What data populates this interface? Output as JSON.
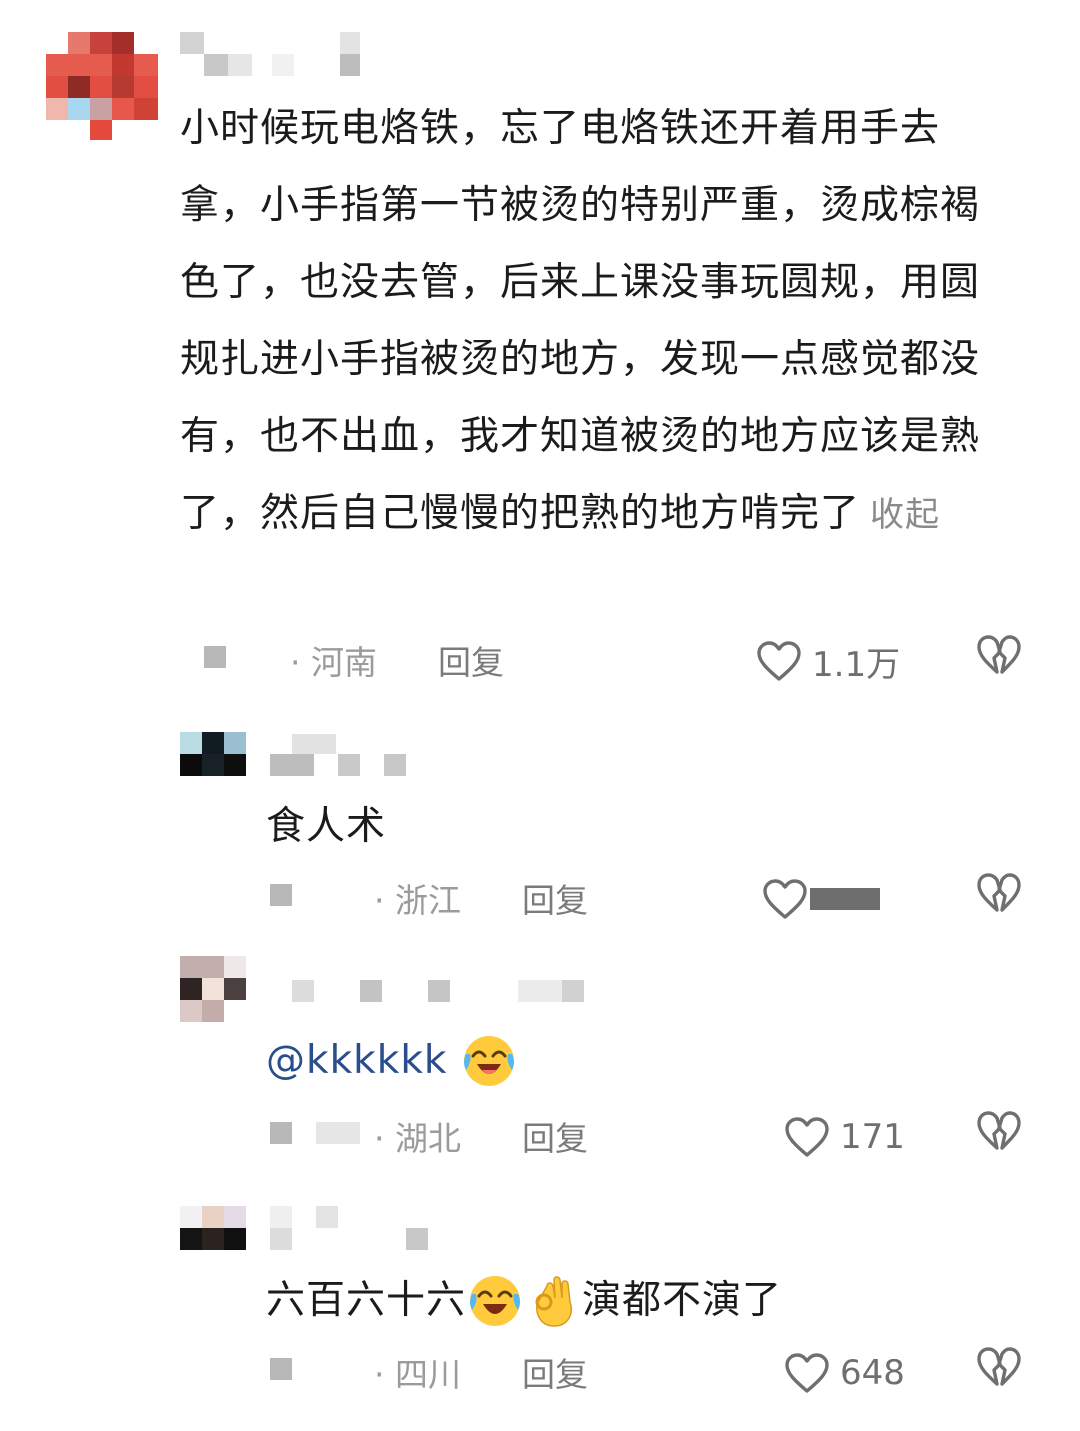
{
  "comments": [
    {
      "text": "小时候玩电烙铁，忘了电烙铁还开着用手去拿，小手指第一节被烫的特别严重，烫成棕褐色了，也没去管，后来上课没事玩圆规，用圆规扎进小手指被烫的地方，发现一点感觉都没有，也不出血，我才知道被烫的地方应该是熟了，然后自己慢慢的把熟的地方啃完了",
      "collapse_label": "收起",
      "region": "· 河南",
      "reply_label": "回复",
      "likes": "1.1万"
    },
    {
      "text": "食人术",
      "region": "· 浙江",
      "reply_label": "回复"
    },
    {
      "mention": "@kkkkkk",
      "emoji": "crying-laughing-emoji",
      "region": "· 湖北",
      "reply_label": "回复",
      "likes": "171"
    },
    {
      "text_before": "六百六十六",
      "emojis": [
        "crying-laughing-emoji",
        "ok-hand-emoji"
      ],
      "text_after": "演都不演了",
      "region": "· 四川",
      "reply_label": "回复",
      "likes": "648"
    }
  ],
  "icons": {
    "like": "heart-outline-icon",
    "dislike": "broken-heart-icon"
  },
  "colors": {
    "mention": "#2a4e8c",
    "meta": "#9b9b9b",
    "icon": "#6f6f6f"
  }
}
